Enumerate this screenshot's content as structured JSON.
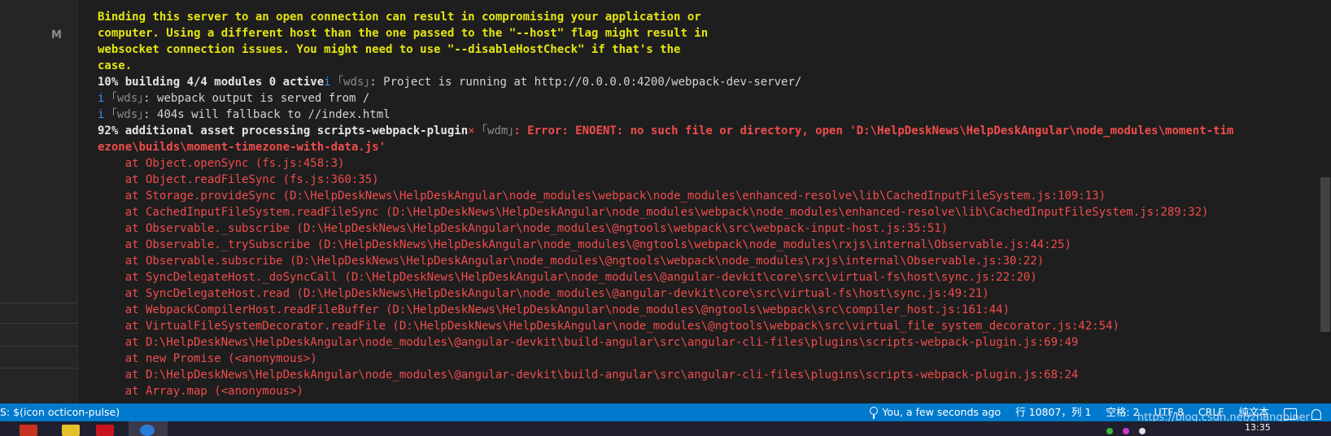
{
  "sidebar": {
    "badge": "M"
  },
  "terminal": {
    "lines": [
      [
        {
          "t": "Binding this server to an open connection can result in compromising your application or",
          "c": "c-yellow"
        }
      ],
      [
        {
          "t": "computer. Using a different host than the one passed to the \"--host\" flag might result in",
          "c": "c-yellow"
        }
      ],
      [
        {
          "t": "websocket connection issues. You might need to use \"--disableHostCheck\" if that's the",
          "c": "c-yellow"
        }
      ],
      [
        {
          "t": "case.",
          "c": "c-yellow"
        }
      ],
      [
        {
          "t": "10% building 4/4 modules 0 active",
          "c": "c-white-b"
        },
        {
          "t": "i ",
          "c": "c-blue"
        },
        {
          "t": "｢wds｣",
          "c": "c-gray"
        },
        {
          "t": ": Project is running at http://0.0.0.0:4200/webpack-dev-server/",
          "c": "c-white"
        }
      ],
      [
        {
          "t": "i ",
          "c": "c-blue"
        },
        {
          "t": "｢wds｣",
          "c": "c-gray"
        },
        {
          "t": ": webpack output is served from /",
          "c": "c-white"
        }
      ],
      [
        {
          "t": "i ",
          "c": "c-blue"
        },
        {
          "t": "｢wds｣",
          "c": "c-gray"
        },
        {
          "t": ": 404s will fallback to //index.html",
          "c": "c-white"
        }
      ],
      [
        {
          "t": "92% additional asset processing scripts-webpack-plugin",
          "c": "c-white-b"
        },
        {
          "t": "× ",
          "c": "c-red"
        },
        {
          "t": "｢wdm｣",
          "c": "c-gray"
        },
        {
          "t": ": Error: ENOENT: no such file or directory, open 'D:\\HelpDeskNews\\HelpDeskAngular\\node_modules\\moment-tim",
          "c": "c-red-b"
        }
      ],
      [
        {
          "t": "ezone\\builds\\moment-timezone-with-data.js'",
          "c": "c-red-b"
        }
      ],
      [
        {
          "t": "    at Object.openSync (fs.js:458:3)",
          "c": "c-stack"
        }
      ],
      [
        {
          "t": "    at Object.readFileSync (fs.js:360:35)",
          "c": "c-stack"
        }
      ],
      [
        {
          "t": "    at Storage.provideSync (D:\\HelpDeskNews\\HelpDeskAngular\\node_modules\\webpack\\node_modules\\enhanced-resolve\\lib\\CachedInputFileSystem.js:109:13)",
          "c": "c-stack"
        }
      ],
      [
        {
          "t": "    at CachedInputFileSystem.readFileSync (D:\\HelpDeskNews\\HelpDeskAngular\\node_modules\\webpack\\node_modules\\enhanced-resolve\\lib\\CachedInputFileSystem.js:289:32)",
          "c": "c-stack"
        }
      ],
      [
        {
          "t": "    at Observable._subscribe (D:\\HelpDeskNews\\HelpDeskAngular\\node_modules\\@ngtools\\webpack\\src\\webpack-input-host.js:35:51)",
          "c": "c-stack"
        }
      ],
      [
        {
          "t": "    at Observable._trySubscribe (D:\\HelpDeskNews\\HelpDeskAngular\\node_modules\\@ngtools\\webpack\\node_modules\\rxjs\\internal\\Observable.js:44:25)",
          "c": "c-stack"
        }
      ],
      [
        {
          "t": "    at Observable.subscribe (D:\\HelpDeskNews\\HelpDeskAngular\\node_modules\\@ngtools\\webpack\\node_modules\\rxjs\\internal\\Observable.js:30:22)",
          "c": "c-stack"
        }
      ],
      [
        {
          "t": "    at SyncDelegateHost._doSyncCall (D:\\HelpDeskNews\\HelpDeskAngular\\node_modules\\@angular-devkit\\core\\src\\virtual-fs\\host\\sync.js:22:20)",
          "c": "c-stack"
        }
      ],
      [
        {
          "t": "    at SyncDelegateHost.read (D:\\HelpDeskNews\\HelpDeskAngular\\node_modules\\@angular-devkit\\core\\src\\virtual-fs\\host\\sync.js:49:21)",
          "c": "c-stack"
        }
      ],
      [
        {
          "t": "    at WebpackCompilerHost.readFileBuffer (D:\\HelpDeskNews\\HelpDeskAngular\\node_modules\\@ngtools\\webpack\\src\\compiler_host.js:161:44)",
          "c": "c-stack"
        }
      ],
      [
        {
          "t": "    at VirtualFileSystemDecorator.readFile (D:\\HelpDeskNews\\HelpDeskAngular\\node_modules\\@ngtools\\webpack\\src\\virtual_file_system_decorator.js:42:54)",
          "c": "c-stack"
        }
      ],
      [
        {
          "t": "    at D:\\HelpDeskNews\\HelpDeskAngular\\node_modules\\@angular-devkit\\build-angular\\src\\angular-cli-files\\plugins\\scripts-webpack-plugin.js:69:49",
          "c": "c-stack"
        }
      ],
      [
        {
          "t": "    at new Promise (<anonymous>)",
          "c": "c-stack"
        }
      ],
      [
        {
          "t": "    at D:\\HelpDeskNews\\HelpDeskAngular\\node_modules\\@angular-devkit\\build-angular\\src\\angular-cli-files\\plugins\\scripts-webpack-plugin.js:68:24",
          "c": "c-stack"
        }
      ],
      [
        {
          "t": "    at Array.map (<anonymous>)",
          "c": "c-stack"
        }
      ]
    ]
  },
  "statusbar": {
    "left_text": "S: $(icon octicon-pulse)",
    "git_blame": "You, a few seconds ago",
    "position": "行 10807，列 1",
    "indent": "空格: 2",
    "encoding": "UTF-8",
    "eol": "CRLF",
    "language": "纯文本"
  },
  "watermark": "https://blog.csdn.net/zhangpiner",
  "taskbar": {
    "clock": "13:35"
  },
  "colors": {
    "statusbar_bg": "#007acc",
    "terminal_bg": "#1e1e1e",
    "warning_yellow": "#e5e510",
    "error_red": "#f14c4c"
  }
}
